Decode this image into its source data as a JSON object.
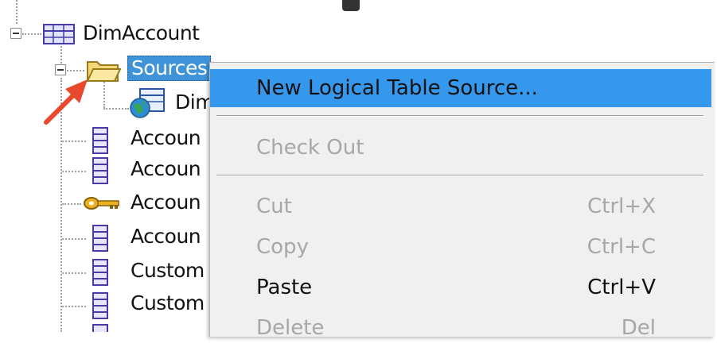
{
  "tree": {
    "root_label": "DimAccount",
    "sources_label": "Sources",
    "child_label": "Dim",
    "columns": [
      "Accoun",
      "Accoun",
      "Accoun",
      "Accoun",
      "Custom",
      "Custom",
      ""
    ]
  },
  "context_menu": {
    "new_lts": "New Logical Table Source...",
    "check_out": "Check Out",
    "cut": "Cut",
    "cut_shortcut": "Ctrl+X",
    "copy": "Copy",
    "copy_shortcut": "Ctrl+C",
    "paste": "Paste",
    "paste_shortcut": "Ctrl+V",
    "delete": "Delete",
    "delete_shortcut": "Del"
  },
  "colors": {
    "menu_highlight": "#3598ec",
    "selection": "#3f93d8",
    "arrow": "#e8482c"
  },
  "icons": [
    "table-icon",
    "folder-icon",
    "globe-table-icon",
    "column-icon",
    "key-icon"
  ]
}
